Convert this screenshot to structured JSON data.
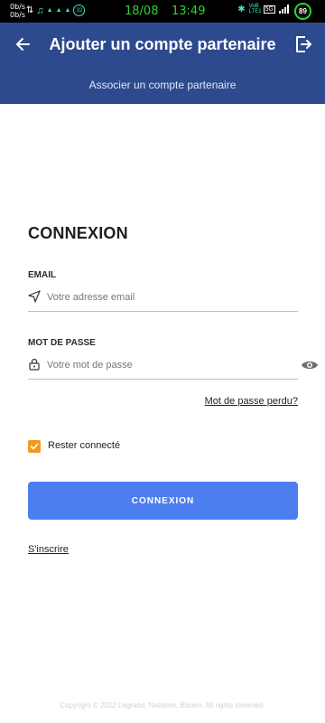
{
  "status_bar": {
    "speed_up": "0b/s",
    "speed_down": "0b/s",
    "date": "18/08",
    "time": "13:49",
    "network": "5G",
    "volte": "VoB LTE1",
    "battery": "89",
    "colors": {
      "clock": "#2fd12f",
      "icons": "#3ee6c9"
    }
  },
  "header": {
    "title": "Ajouter un compte partenaire",
    "subtitle": "Associer un compte partenaire",
    "back_icon": "arrow-left-icon",
    "logout_icon": "logout-icon",
    "background": "#2d4a8e"
  },
  "form": {
    "title": "CONNEXION",
    "email": {
      "label": "EMAIL",
      "placeholder": "Votre adresse email",
      "value": "",
      "icon": "send-icon"
    },
    "password": {
      "label": "MOT DE PASSE",
      "placeholder": "Votre mot de passe",
      "value": "",
      "icon": "lock-icon",
      "toggle_icon": "eye-icon"
    },
    "forgot_password": "Mot de passe perdu?",
    "remember_me": {
      "label": "Rester connecté",
      "checked": true,
      "color": "#f39a1e"
    },
    "submit_label": "CONNEXION",
    "submit_color": "#4d7ef0",
    "signup_link": "S'inscrire"
  },
  "footer": {
    "copyright": "Copyright © 2022 Legrand, Netatmo, Bticino. All rights reserved."
  }
}
